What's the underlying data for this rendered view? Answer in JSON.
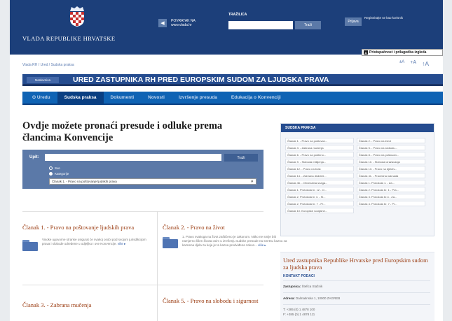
{
  "header": {
    "site_name": "VLADA REPUBLIKE HRVATSKE",
    "back_link": "POVRATAK NA\nwww.vlada.hr",
    "search_label": "TRAŽILICA",
    "search_button": "Traži",
    "login_button": "Prijava",
    "register_text": "Registrirajte se kao korisnik",
    "accessibility": "Pristupačnost i prilagodba izgleda",
    "accessibility_icon": "A"
  },
  "breadcrumb": "Vlada RH / Ured / Sudska praksa",
  "font_controls": [
    "±A",
    "+A",
    "↑A"
  ],
  "title": {
    "tag": "Naslovnica",
    "main": "URED ZASTUPNIKA RH PRED EUROPSKIM SUDOM ZA LJUDSKA PRAVA"
  },
  "nav": {
    "tabs": [
      {
        "label": "O Uredu"
      },
      {
        "label": "Sudska praksa"
      },
      {
        "label": "Dokumenti"
      },
      {
        "label": "Novosti"
      },
      {
        "label": "Izvršenje presuda"
      },
      {
        "label": "Edukacija o Konvenciji"
      }
    ]
  },
  "main": {
    "heading": "Ovdje možete pronaći presude i odluke prema člancima Konvencije",
    "search": {
      "label": "Upit:",
      "input_value": "",
      "button": "Traži",
      "radio_all": "Sve",
      "radio_category": "Kategorije",
      "select_value": "Članak 1. - Pravo na poštovanje ljudskih prava",
      "select_arrow": "▼"
    }
  },
  "articles": [
    {
      "title": "Članak 1. - Pravo na poštovanje ljudskih prava",
      "text": "Visoke ugovorne stranke osigurat će svakoj osobi pod svojom jurisdikcijom prava i slobode određene u odjeljku I ove Konvencije.",
      "more": "više ▸"
    },
    {
      "title": "Članak 2. - Pravo na život",
      "text": "1. Pravo svakoga na život zaštićeno je zakonom. Nitko ne smije biti namjerno lišen života osim u izvršenju sudske presude na smrtnu kaznu za kaznena djela za koja je ta kazna predviđena zakon...",
      "more": "više ▸"
    },
    {
      "title": "Članak 3. - Zabrana mučenja"
    },
    {
      "title": "Članak 5. - Pravo na slobodu i sigurnost"
    }
  ],
  "sidebar": {
    "practice_title": "SUDSKA PRAKSA",
    "items": [
      "Članak 1. - Pravo na poštovan...",
      "Članak 2. - Pravo na život",
      "Članak 3. - Zabrana mučenja",
      "Članak 5. - Pravo na slobodu...",
      "Članak 6. - Pravo na pošteno...",
      "Članak 8. - Pravo na poštovan...",
      "Članak 9. - Sloboda mišljenja...",
      "Članak 10. - Sloboda izražavanja",
      "Članak 12. - Pravo na brak",
      "Članak 13. - Pravo na djelotv...",
      "Članak 14. - Zabrana diskrimi...",
      "Članak 41. - Pravedna naknada",
      "Članak 46. - Obvezatna snaga...",
      "Članak 1. Protokola 1. - Za...",
      "Članak 1. Protokola br. 12 - O...",
      "Članak 2. Protokola br. 1 - Pra...",
      "Članak 2. Protokola br 4. - Sl...",
      "Članak 3. Protokola br.4 - Za...",
      "Članak 2. Protokola br. 7 - Pr...",
      "Članak 4. Protokola br. 7 - Pr...",
      "Članak 10. Europske socijalne..."
    ],
    "contact": {
      "title": "Ured zastupnika Republike Hrvatske pred Europskim sudom za ljudska prava",
      "head": "KONTAKT PODACI",
      "representative_label": "Zastupnica:",
      "representative": "Štefica Stažnik",
      "address_label": "Adresa:",
      "address": "Dalmatinska 1, 10000 ZAGREB",
      "phone": "T: +385 (0) 1 4878 100",
      "fax": "F: +385 (0) 1 4878 111"
    }
  }
}
